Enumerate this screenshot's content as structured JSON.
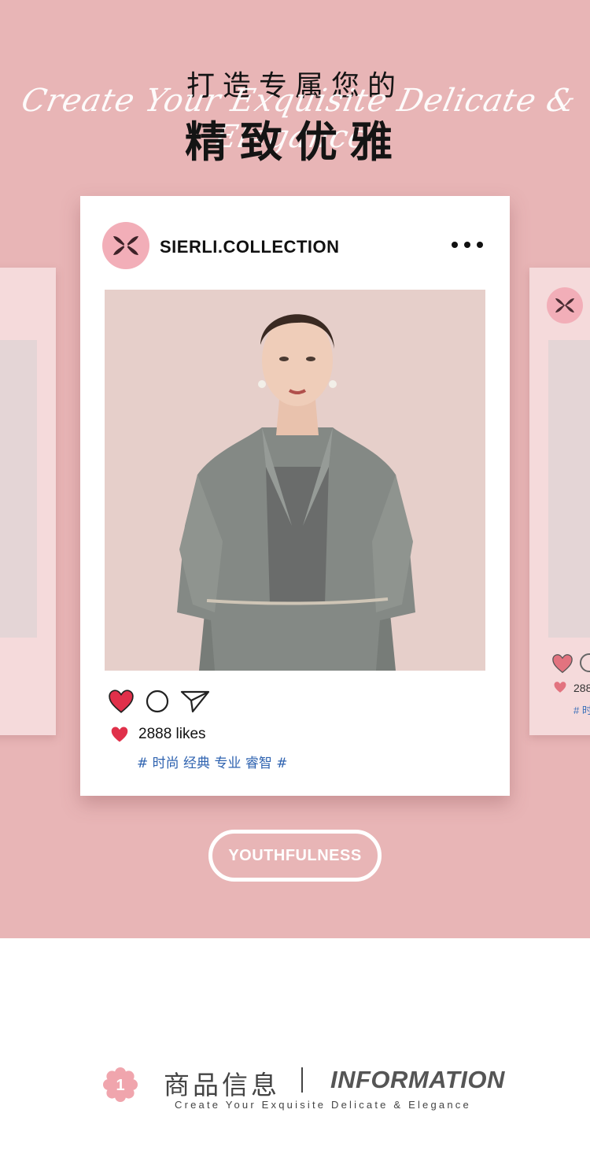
{
  "colors": {
    "hero_background": "#e8b5b6",
    "side_card": "#f5dadb",
    "avatar_bg": "#f2aeb8",
    "heart": "#e0304a",
    "hashtag": "#2f63b0"
  },
  "hero": {
    "title_line1": "打造专属您的",
    "title_line2": "精致优雅",
    "script_text": "Create Your Exquisite Delicate & Elegance"
  },
  "post": {
    "handle": "SIERLI.COLLECTION",
    "more_icon": "more-dots-icon",
    "action_icons": [
      "heart-icon",
      "comment-icon",
      "share-icon"
    ],
    "likes": "2888 likes",
    "hashtags": "# 时尚 经典 专业 睿智 #"
  },
  "side_card": {
    "likes": "288",
    "tag": "# 时"
  },
  "button": {
    "label": "YOUTHFULNESS"
  },
  "info": {
    "badge_number": "1",
    "title_cn": "商品信息",
    "title_en": "INFORMATION",
    "subtitle": "Create Your Exquisite Delicate & Elegance"
  }
}
